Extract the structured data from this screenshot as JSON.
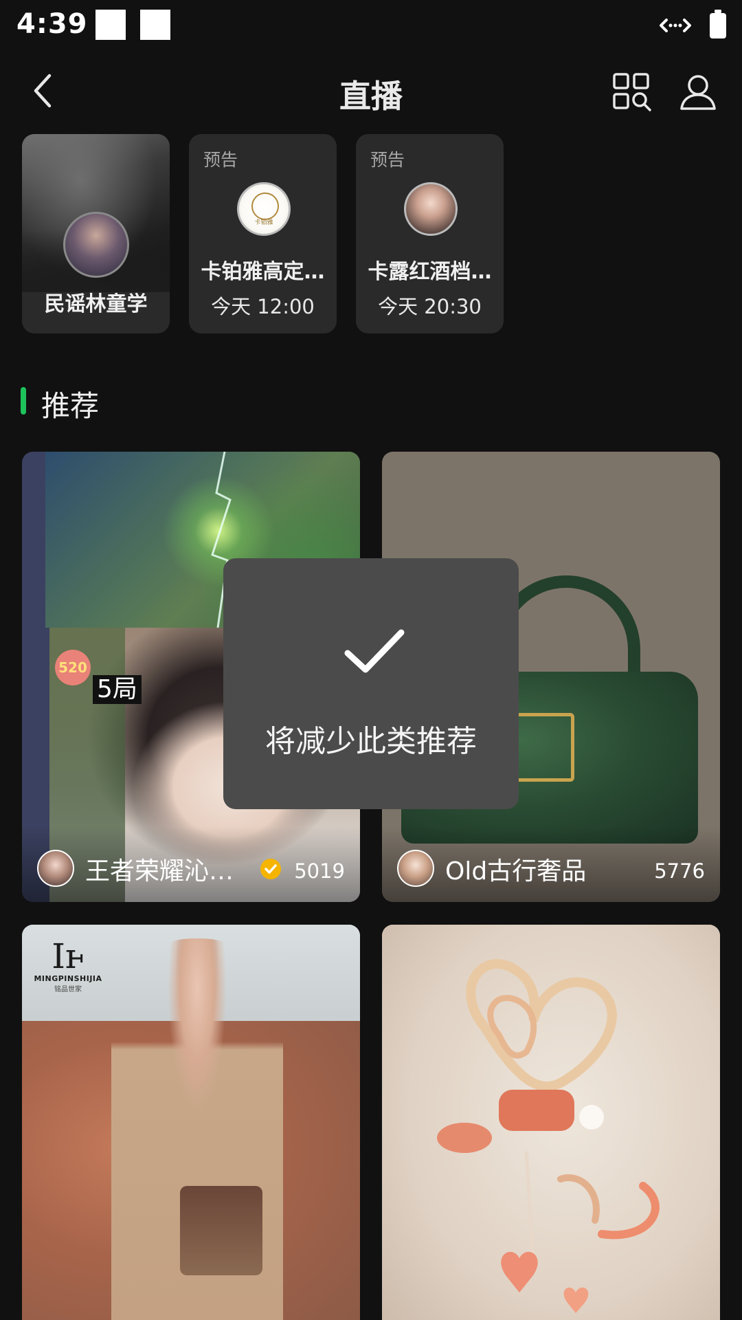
{
  "status_bar": {
    "time": "4:39"
  },
  "header": {
    "title": "直播"
  },
  "live_now": {
    "name": "民谣林童学"
  },
  "previews": [
    {
      "tag": "预告",
      "name": "卡铂雅高定…",
      "time": "今天 12:00",
      "logo_text": "卡铂雅"
    },
    {
      "tag": "预告",
      "name": "卡露红酒档…",
      "time": "今天 20:30"
    }
  ],
  "section": {
    "title": "推荐"
  },
  "feed": [
    {
      "title": "王者荣耀沁…",
      "viewers": "5019",
      "badge_text": "520",
      "rounds": "5局"
    },
    {
      "title": "Old古行奢品",
      "viewers": "5776"
    },
    {
      "brand_line1": "MINGPINSHIJIA",
      "brand_line2": "铭品世家"
    },
    {}
  ],
  "toast": {
    "message": "将减少此类推荐"
  },
  "colors": {
    "background": "#111111",
    "accent": "#1ec25a",
    "card": "#2a2a2a",
    "toast": "#4b4b4b",
    "verified": "#f5b400"
  }
}
